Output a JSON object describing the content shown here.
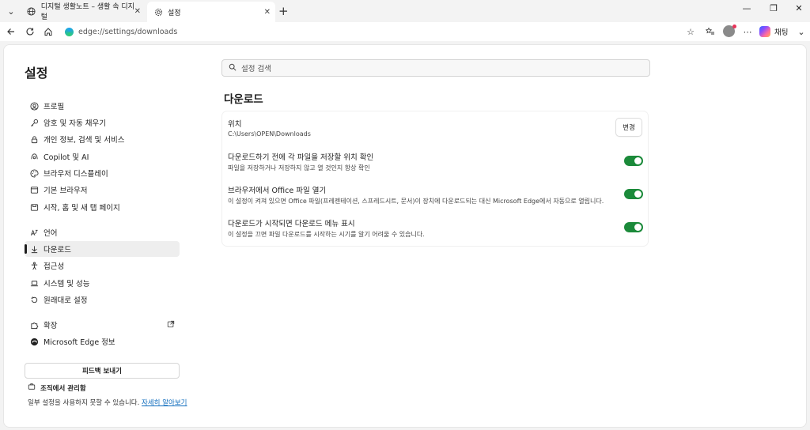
{
  "tabs": [
    {
      "title": "디지털 생활노트 – 생활 속 디지털",
      "icon": "globe-icon",
      "active": false
    },
    {
      "title": "설정",
      "icon": "gear-icon",
      "active": true
    }
  ],
  "address": {
    "url": "edge://settings/downloads"
  },
  "toolbar": {
    "chat_label": "채팅"
  },
  "sidebar": {
    "title": "설정",
    "items": [
      {
        "label": "프로필",
        "icon": "profile-icon"
      },
      {
        "label": "암호 및 자동 채우기",
        "icon": "key-icon"
      },
      {
        "label": "개인 정보, 검색 및 서비스",
        "icon": "lock-icon"
      },
      {
        "label": "Copilot 및 AI",
        "icon": "copilot-icon"
      },
      {
        "label": "브라우저 디스플레이",
        "icon": "palette-icon"
      },
      {
        "label": "기본 브라우저",
        "icon": "browser-icon"
      },
      {
        "label": "시작, 홈 및 새 탭 페이지",
        "icon": "home-tab-icon"
      },
      {
        "label": "언어",
        "icon": "language-icon"
      },
      {
        "label": "다운로드",
        "icon": "download-icon",
        "active": true
      },
      {
        "label": "접근성",
        "icon": "accessibility-icon"
      },
      {
        "label": "시스템 및 성능",
        "icon": "laptop-icon"
      },
      {
        "label": "원래대로 설정",
        "icon": "reset-icon"
      },
      {
        "label": "확장",
        "icon": "puzzle-icon"
      },
      {
        "label": "Microsoft Edge 정보",
        "icon": "edge-icon"
      }
    ],
    "feedback_label": "피드백 보내기",
    "org_label": "조직에서 관리함",
    "org_note": "일부 설정을 사용하지 못할 수 있습니다.",
    "org_link": "자세히 알아보기"
  },
  "search": {
    "placeholder": "설정 검색"
  },
  "section": {
    "title": "다운로드",
    "location_title": "위치",
    "location_path": "C:\\Users\\OPEN\\Downloads",
    "change_label": "변경",
    "options": [
      {
        "title": "다운로드하기 전에 각 파일을 저장할 위치 확인",
        "desc": "파일을 저장하거나 저장하지 않고 열 것인지 항상 확인",
        "enabled": true
      },
      {
        "title": "브라우저에서 Office 파일 열기",
        "desc": "이 설정이 켜져 있으면 Office 파일(프레젠테이션, 스프레드시트, 문서)이 장치에 다운로드되는 대신 Microsoft Edge에서 자동으로 열립니다.",
        "enabled": true
      },
      {
        "title": "다운로드가 시작되면 다운로드 메뉴 표시",
        "desc": "이 설정을 끄면 파일 다운로드를 시작하는 시기를 알기 어려울 수 있습니다.",
        "enabled": true
      }
    ]
  },
  "colors": {
    "toggle_on": "#1b8a3a",
    "link": "#0f6cbd"
  }
}
